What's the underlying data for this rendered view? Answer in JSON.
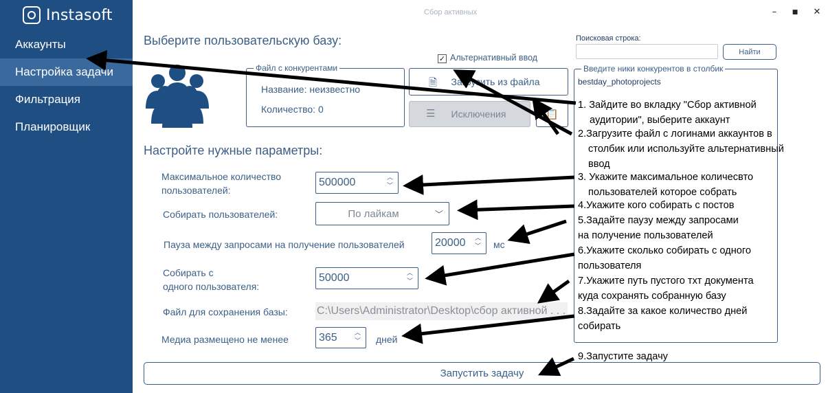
{
  "app": {
    "logo_text": "Instasoft",
    "window_title": "Сбор активных"
  },
  "window_controls": {
    "minimize": "–",
    "maximize": "■",
    "close": "✕"
  },
  "sidebar": {
    "items": [
      {
        "label": "Аккаунты",
        "active": false
      },
      {
        "label": "Настройка задачи",
        "active": true
      },
      {
        "label": "Фильтрация",
        "active": false
      },
      {
        "label": "Планировщик",
        "active": false
      }
    ]
  },
  "base": {
    "title": "Выберите пользовательскую базу:",
    "alt_input_label": "Альтернативный ввод",
    "alt_input_checked": true,
    "competitors_box": {
      "legend": "Файл с конкурентами",
      "name_label": "Название: неизвестно",
      "count_label": "Количество: 0"
    },
    "load_button": "Загрузить из файла",
    "exclusions_button": "Исключения"
  },
  "search": {
    "label": "Поисковая строка:",
    "value": "",
    "button": "Найти"
  },
  "nicks_box": {
    "legend": "Введите ники конкурентов в столбик",
    "value": "bestday_photoprojects"
  },
  "params": {
    "title": "Настройте нужные параметры:",
    "max_users_label_1": "Максимальное количество",
    "max_users_label_2": "пользователей:",
    "max_users_value": "500000",
    "collect_label": "Собирать пользователей:",
    "collect_value": "По лайкам",
    "pause_label": "Пауза между запросами на получение пользователей",
    "pause_value": "20000",
    "pause_unit": "мс",
    "per_user_label_1": "Собирать с",
    "per_user_label_2": "одного пользователя:",
    "per_user_value": "50000",
    "save_file_label": "Файл для сохранения базы:",
    "save_file_value": "C:\\Users\\Administrator\\Desktop\\сбор активной . . .",
    "media_label": "Медиа размещено не менее",
    "media_value": "365",
    "media_unit": "дней"
  },
  "start_button": "Запустить задачу",
  "instructions": {
    "l1a": "1. Зайдите во вкладку \"Сбор активной",
    "l1b": "аудитории\", выберите аккаунт",
    "l2a": "2.Загрузите файл с логинами аккаунтов в",
    "l2b": "столбик или используйте альтернативный",
    "l2c": "ввод",
    "l3a": "3. Укажите максимальное количесвто",
    "l3b": "пользователей которое собрать",
    "l4": "4.Укажите кого собирать с постов",
    "l5a": "5.Задайте паузу между запросами",
    "l5b": "на получение пользователей",
    "l6a": "6.Укажите сколько собирать с одного",
    "l6b": "пользователя",
    "l7a": "7.Укажите путь пустого тхт документа",
    "l7b": "куда сохранять собранную базу",
    "l8a": "8.Задайте за какое количество дней",
    "l8b": "собирать",
    "l9": "9.Запустите задачу"
  }
}
